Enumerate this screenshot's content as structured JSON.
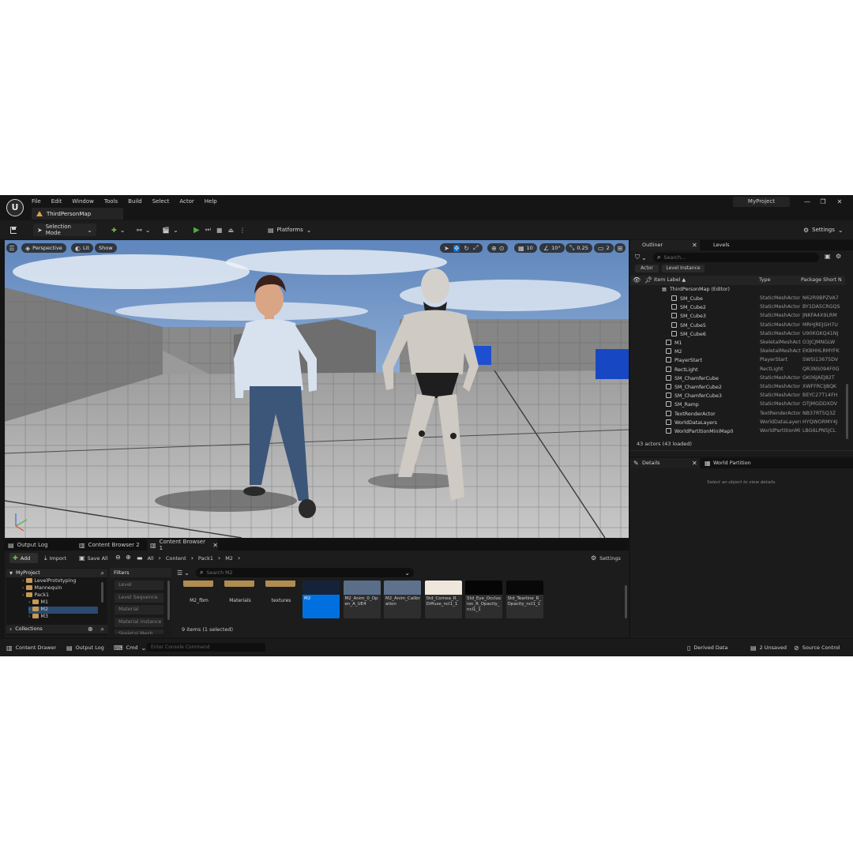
{
  "menu": [
    "File",
    "Edit",
    "Window",
    "Tools",
    "Build",
    "Select",
    "Actor",
    "Help"
  ],
  "map_tab": "ThirdPersonMap",
  "project_name": "MyProject",
  "toolbar": {
    "selection_mode": "Selection Mode",
    "platforms": "Platforms",
    "settings": "Settings"
  },
  "viewport": {
    "perspective": "Perspective",
    "lit": "Lit",
    "show": "Show",
    "grid_snap": "10",
    "rotation_snap": "10°",
    "scale_snap": "0.25",
    "camera_speed": "2"
  },
  "outliner": {
    "tab": "Outliner",
    "levels_tab": "Levels",
    "search_placeholder": "Search...",
    "filter_actor": "Actor",
    "filter_level_instance": "Level Instance",
    "col_label": "Item Label ▲",
    "col_type": "Type",
    "col_package": "Package Short N",
    "root": "ThirdPersonMap (Editor)",
    "rows": [
      {
        "label": "SM_Cube",
        "type": "StaticMeshActor",
        "pkg": "N62R9BPZVA7",
        "indent": 2
      },
      {
        "label": "SM_Cube2",
        "type": "StaticMeshActor",
        "pkg": "BY1DA5CRGQS",
        "indent": 2
      },
      {
        "label": "SM_Cube3",
        "type": "StaticMeshActor",
        "pkg": "JNKFA4X9LRM",
        "indent": 2
      },
      {
        "label": "SM_Cube5",
        "type": "StaticMeshActor",
        "pkg": "MRHJREJGH7U",
        "indent": 2
      },
      {
        "label": "SM_Cube6",
        "type": "StaticMeshActor",
        "pkg": "U90KGKQ41NJ",
        "indent": 2
      },
      {
        "label": "M1",
        "type": "SkeletalMeshActor",
        "pkg": "O3JCJMNGLW",
        "indent": 1
      },
      {
        "label": "M2",
        "type": "SkeletalMeshActor",
        "pkg": "EKBHHLRMYFK",
        "indent": 1
      },
      {
        "label": "PlayerStart",
        "type": "PlayerStart",
        "pkg": "SWSI13675DV",
        "indent": 1
      },
      {
        "label": "RectLight",
        "type": "RectLight",
        "pkg": "QR3NS094F0G",
        "indent": 1
      },
      {
        "label": "SM_ChamferCube",
        "type": "StaticMeshActor",
        "pkg": "GK06JAEJ82T",
        "indent": 1
      },
      {
        "label": "SM_ChamferCube2",
        "type": "StaticMeshActor",
        "pkg": "XWFFRCIJ8QK",
        "indent": 1
      },
      {
        "label": "SM_ChamferCube3",
        "type": "StaticMeshActor",
        "pkg": "BEYC27T14FH",
        "indent": 1
      },
      {
        "label": "SM_Ramp",
        "type": "StaticMeshActor",
        "pkg": "OTJMGDDXDV",
        "indent": 1
      },
      {
        "label": "TextRenderActor",
        "type": "TextRenderActor",
        "pkg": "NB37RT5Q3Z",
        "indent": 1
      },
      {
        "label": "WorldDataLayers",
        "type": "WorldDataLayers",
        "pkg": "HYQWORMY4J",
        "indent": 1
      },
      {
        "label": "WorldPartitionMiniMap0",
        "type": "WorldPartitionMiniMap",
        "pkg": "LBG6LPN5JCL",
        "indent": 1
      }
    ],
    "count": "43 actors (43 loaded)"
  },
  "details": {
    "tab": "Details",
    "world_partition_tab": "World Partition",
    "empty_msg": "Select an object to view details."
  },
  "bottom_tabs": [
    "Output Log",
    "Content Browser 2",
    "Content Browser 1"
  ],
  "content_browser": {
    "add": "Add",
    "import": "Import",
    "save_all": "Save All",
    "breadcrumb": [
      "All",
      "Content",
      "Pack1",
      "M2"
    ],
    "settings": "Settings",
    "root": "MyProject",
    "tree": [
      {
        "label": "LevelPrototyping",
        "indent": 1,
        "selected": false
      },
      {
        "label": "Mannequin",
        "indent": 1,
        "selected": false
      },
      {
        "label": "Pack1",
        "indent": 1,
        "selected": false
      },
      {
        "label": "M1",
        "indent": 2,
        "selected": false
      },
      {
        "label": "M2",
        "indent": 2,
        "selected": true
      },
      {
        "label": "M3",
        "indent": 2,
        "selected": false
      }
    ],
    "collections": "Collections",
    "filters_title": "Filters",
    "filters": [
      "Level",
      "Level Sequence",
      "Material",
      "Material Instance",
      "Skeletal Mesh"
    ],
    "search_placeholder": "Search M2",
    "folders": [
      "M2_fbm",
      "Materials",
      "textures"
    ],
    "assets": [
      {
        "name": "M2",
        "selected": true,
        "thumb": "#14233a"
      },
      {
        "name": "M2_Anim_0_Open_A_UE4",
        "selected": false,
        "thumb": "#5a6e8a"
      },
      {
        "name": "M2_Anim_Calibration",
        "selected": false,
        "thumb": "#5e728e"
      },
      {
        "name": "Std_Cornea_R_Diffuse_ncl1_1",
        "selected": false,
        "thumb": "#efe6dc"
      },
      {
        "name": "Std_Eye_Occlusion_R_Opacity_ncl1_1",
        "selected": false,
        "thumb": "#050505"
      },
      {
        "name": "Std_Tearline_R_Opacity_ncl1_1",
        "selected": false,
        "thumb": "#080808"
      }
    ],
    "item_count": "9 items (1 selected)"
  },
  "status": {
    "content_drawer": "Content Drawer",
    "output_log": "Output Log",
    "cmd": "Cmd",
    "console_placeholder": "Enter Console Command",
    "derived_data": "Derived Data",
    "unsaved": "2 Unsaved",
    "source_control": "Source Control"
  },
  "colors": {
    "accent_blue": "#0070e0",
    "play_green": "#4caf3c",
    "panel": "#1b1b1b",
    "folder": "#c49a55"
  }
}
